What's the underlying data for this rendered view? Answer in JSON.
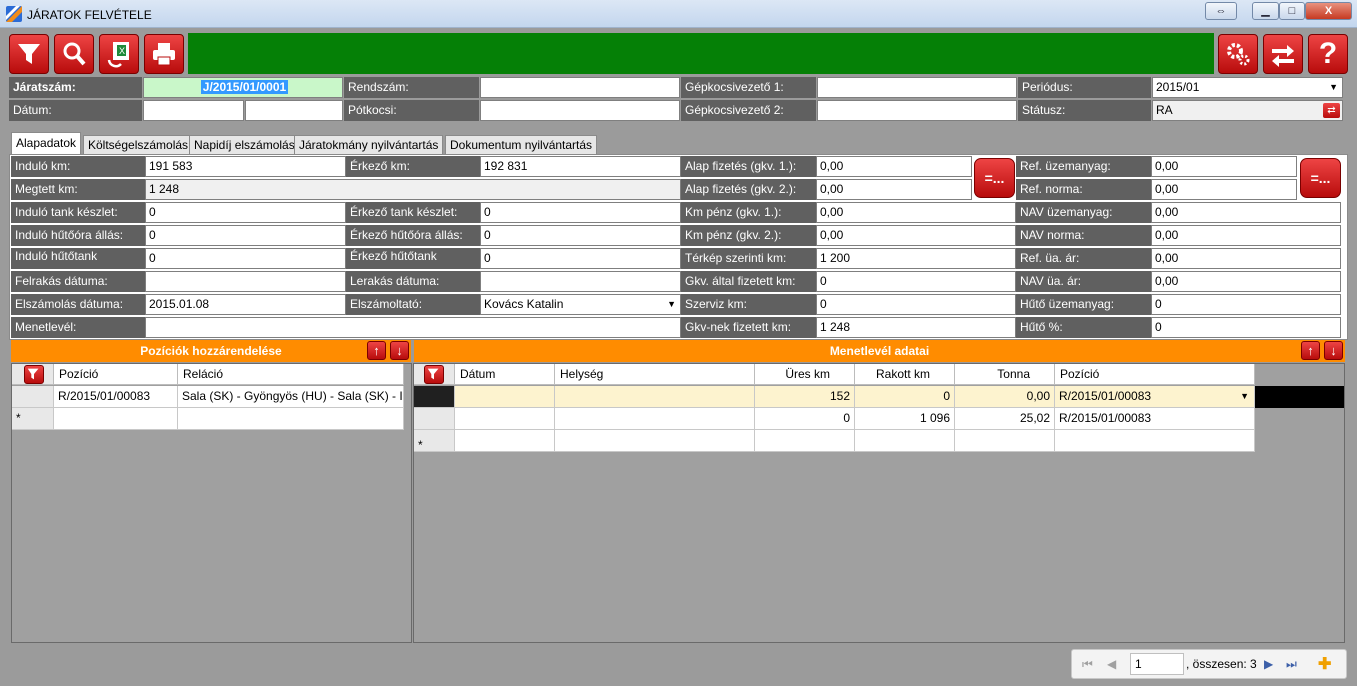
{
  "window": {
    "title": "JÁRATOK FELVÉTELE",
    "restore_glyph": "⇔",
    "min_glyph": "▁",
    "max_glyph": "□",
    "close_glyph": "X"
  },
  "toolbar": {
    "icons": [
      "filter-icon",
      "search-icon",
      "excel-export-icon",
      "print-icon",
      "settings-icon",
      "switch-icon",
      "help-icon"
    ],
    "help_glyph": "?"
  },
  "header": {
    "jaratszam_label": "Járatszám:",
    "jaratszam_value": "J/2015/01/0001",
    "rendszam_label": "Rendszám:",
    "rendszam_value": "",
    "sofor1_label": "Gépkocsivezető 1:",
    "sofor1_value": "",
    "periodus_label": "Periódus:",
    "periodus_value": "2015/01",
    "datum_label": "Dátum:",
    "datum_value1": "",
    "datum_value2": "",
    "potkocsi_label": "Pótkocsi:",
    "potkocsi_value": "",
    "sofor2_label": "Gépkocsivezető 2:",
    "sofor2_value": "",
    "status_label": "Státusz:",
    "status_value": "RA"
  },
  "tabs": [
    "Alapadatok",
    "Költségelszámolás",
    "Napidíj elszámolás",
    "Járatokmány nyilvántartás",
    "Dokumentum nyilvántartás"
  ],
  "form": {
    "indulo_km_label": "Induló km:",
    "indulo_km": "191 583",
    "erkezo_km_label": "Érkező km:",
    "erkezo_km": "192 831",
    "alap1_label": "Alap fizetés (gkv. 1.):",
    "alap1": "0,00",
    "ref_ua_label": "Ref. üzemanyag:",
    "ref_ua": "0,00",
    "megtett_km_label": "Megtett km:",
    "megtett_km": "1 248",
    "alap2_label": "Alap fizetés (gkv. 2.):",
    "alap2": "0,00",
    "ref_norma_label": "Ref. norma:",
    "ref_norma": "0,00",
    "indulo_tank_label": "Induló tank készlet:",
    "indulo_tank": "0",
    "erkezo_tank_label": "Érkező tank készlet:",
    "erkezo_tank": "0",
    "km_penz1_label": "Km pénz (gkv. 1.):",
    "km_penz1": "0,00",
    "nav_ua_label": "NAV üzemanyag:",
    "nav_ua": "0,00",
    "indulo_huto_ora_label": "Induló hűtőóra állás:",
    "indulo_huto_ora": "0",
    "erkezo_huto_ora_label": "Érkező hűtőóra állás:",
    "erkezo_huto_ora": "0",
    "km_penz2_label": "Km pénz (gkv. 2.):",
    "km_penz2": "0,00",
    "nav_norma_label": "NAV norma:",
    "nav_norma": "0,00",
    "indulo_hutotank_label": "Induló hűtőtank",
    "indulo_hutotank": "0",
    "erkezo_hutotank_label": "Érkező hűtőtank",
    "erkezo_hutotank": "0",
    "terkep_km_label": "Térkép szerinti km:",
    "terkep_km": "1 200",
    "ref_ua_ar_label": "Ref. üa. ár:",
    "ref_ua_ar": "0,00",
    "felrakas_label": "Felrakás dátuma:",
    "felrakas": "",
    "lerakas_label": "Lerakás dátuma:",
    "lerakas": "",
    "gkv_fizetett_label": "Gkv. által fizetett km:",
    "gkv_fizetett": "0",
    "nav_ua_ar_label": "NAV üa. ár:",
    "nav_ua_ar": "0,00",
    "elszamolas_label": "Elszámolás dátuma:",
    "elszamolas": "2015.01.08",
    "elszamoltato_label": "Elszámoltató:",
    "elszamoltato": "Kovács Katalin",
    "szerviz_km_label": "Szerviz km:",
    "szerviz_km": "0",
    "huto_ua_label": "Hűtő üzemanyag:",
    "huto_ua": "0",
    "menetlevel_label": "Menetlevél:",
    "menetlevel": "",
    "gkv_nek_label": "Gkv-nek fizetett km:",
    "gkv_nek": "1 248",
    "huto_pct_label": "Hűtő %:",
    "huto_pct": "0",
    "equal_glyph": "=..."
  },
  "poziciok": {
    "title": "Pozíciók hozzárendelése",
    "columns": [
      "Pozíció",
      "Reláció"
    ],
    "rows": [
      [
        "R/2015/01/00083",
        "Sala (SK) - Gyöngyös (HU) - Sala (SK) - I"
      ]
    ],
    "new_row_marker": "*"
  },
  "menetlevel_adatai": {
    "title": "Menetlevél adatai",
    "columns": [
      "Dátum",
      "Helység",
      "Üres km",
      "Rakott km",
      "Tonna",
      "Pozíció"
    ],
    "rows": [
      [
        "",
        "",
        "152",
        "0",
        "0,00",
        "R/2015/01/00083"
      ],
      [
        "",
        "",
        "0",
        "1 096",
        "25,02",
        "R/2015/01/00083"
      ]
    ],
    "new_row_marker": "*"
  },
  "pager": {
    "current": "1",
    "total_text": ", összesen: 3"
  },
  "colors": {
    "red": "#d42020",
    "green": "#058006",
    "orange": "#ff8c00",
    "label_gray": "#606060"
  }
}
